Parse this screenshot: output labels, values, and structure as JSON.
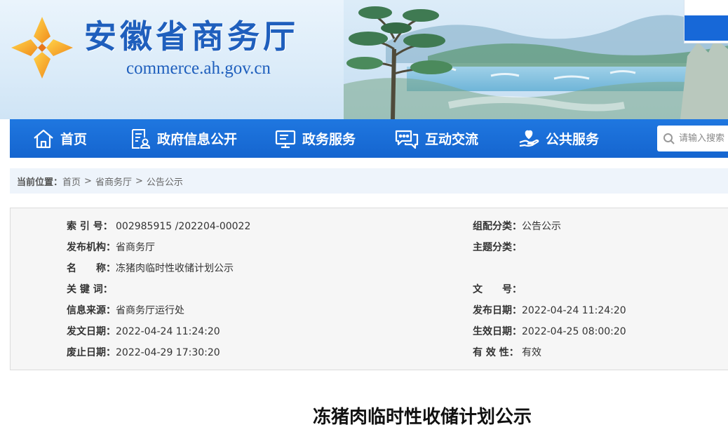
{
  "header": {
    "site_title": "安徽省商务厅",
    "site_domain": "commerce.ah.gov.cn",
    "logo_icon": "star-logo-icon",
    "colors": {
      "brand_blue": "#1f5fbd",
      "nav_blue": "#1768d8",
      "logo_orange": "#f5a623"
    }
  },
  "nav": {
    "items": [
      {
        "label": "首页",
        "icon": "home-icon"
      },
      {
        "label": "政府信息公开",
        "icon": "document-user-icon"
      },
      {
        "label": "政务服务",
        "icon": "monitor-icon"
      },
      {
        "label": "互动交流",
        "icon": "chat-bubbles-icon"
      },
      {
        "label": "公共服务",
        "icon": "hand-heart-icon"
      }
    ],
    "search_placeholder": "请输入搜索"
  },
  "breadcrumb": {
    "label": "当前位置：",
    "items": [
      "首页",
      "省商务厅",
      "公告公示"
    ],
    "separator": ">"
  },
  "meta": {
    "index_no": {
      "label": "索 引 号：",
      "value": "002985915 /202204-00022"
    },
    "category": {
      "label": "组配分类：",
      "value": "公告公示"
    },
    "publisher": {
      "label": "发布机构：",
      "value": "省商务厅"
    },
    "topic": {
      "label": "主题分类：",
      "value": ""
    },
    "name": {
      "label": "名　　称：",
      "value": "冻猪肉临时性收储计划公示"
    },
    "keywords": {
      "label": "关 键 词：",
      "value": ""
    },
    "doc_no": {
      "label": "文　　号：",
      "value": ""
    },
    "source": {
      "label": "信息来源：",
      "value": "省商务厅运行处"
    },
    "publish_date": {
      "label": "发布日期：",
      "value": "2022-04-24 11:24:20"
    },
    "issue_date": {
      "label": "发文日期：",
      "value": "2022-04-24 11:24:20"
    },
    "effective_date": {
      "label": "生效日期：",
      "value": "2022-04-25 08:00:20"
    },
    "expiry_date": {
      "label": "废止日期：",
      "value": "2022-04-29 17:30:20"
    },
    "validity": {
      "label": "有 效 性：",
      "value": "有效"
    }
  },
  "article": {
    "title": "冻猪肉临时性收储计划公示"
  }
}
